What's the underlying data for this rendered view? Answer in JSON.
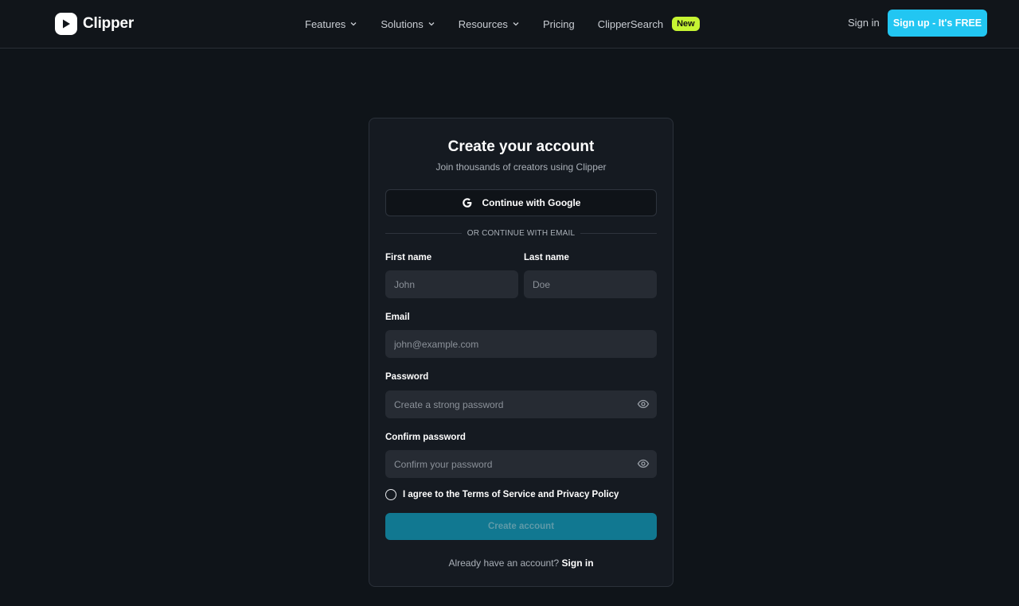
{
  "header": {
    "logo_text": "Clipper",
    "nav": [
      {
        "label": "Features",
        "dropdown": true
      },
      {
        "label": "Solutions",
        "dropdown": true
      },
      {
        "label": "Resources",
        "dropdown": true
      },
      {
        "label": "Pricing",
        "dropdown": false
      },
      {
        "label": "ClipperSearch",
        "dropdown": false,
        "badge": "New"
      }
    ],
    "signin_label": "Sign in",
    "signup_label": "Sign up - It's FREE"
  },
  "card": {
    "title": "Create your account",
    "subtitle": "Join thousands of creators using Clipper",
    "google_label": "Continue with Google",
    "divider_text": "OR CONTINUE WITH EMAIL",
    "first_name": {
      "label": "First name",
      "placeholder": "John",
      "value": ""
    },
    "last_name": {
      "label": "Last name",
      "placeholder": "Doe",
      "value": ""
    },
    "email": {
      "label": "Email",
      "placeholder": "john@example.com",
      "value": ""
    },
    "password": {
      "label": "Password",
      "placeholder": "Create a strong password",
      "value": ""
    },
    "confirm_password": {
      "label": "Confirm password",
      "placeholder": "Confirm your password",
      "value": ""
    },
    "agree_text": "I agree to the Terms of Service and Privacy Policy",
    "agree_checked": false,
    "create_label": "Create account",
    "footer_text": "Already have an account?",
    "footer_link": "Sign in"
  },
  "colors": {
    "background": "#0f1419",
    "accent": "#22c6f2",
    "badge": "#c6f432",
    "primary_button_disabled": "#117891"
  },
  "icons": [
    "play-logo-icon",
    "chevron-down-icon",
    "google-icon",
    "eye-icon"
  ]
}
